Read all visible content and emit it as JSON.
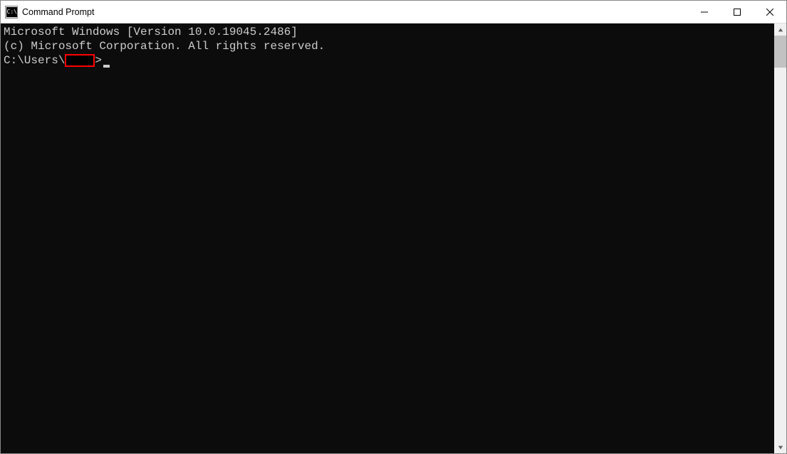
{
  "window": {
    "title": "Command Prompt"
  },
  "terminal": {
    "line1": "Microsoft Windows [Version 10.0.19045.2486]",
    "line2": "(c) Microsoft Corporation. All rights reserved.",
    "blank": "",
    "prompt_prefix": "C:\\Users\\",
    "prompt_suffix": ">"
  }
}
